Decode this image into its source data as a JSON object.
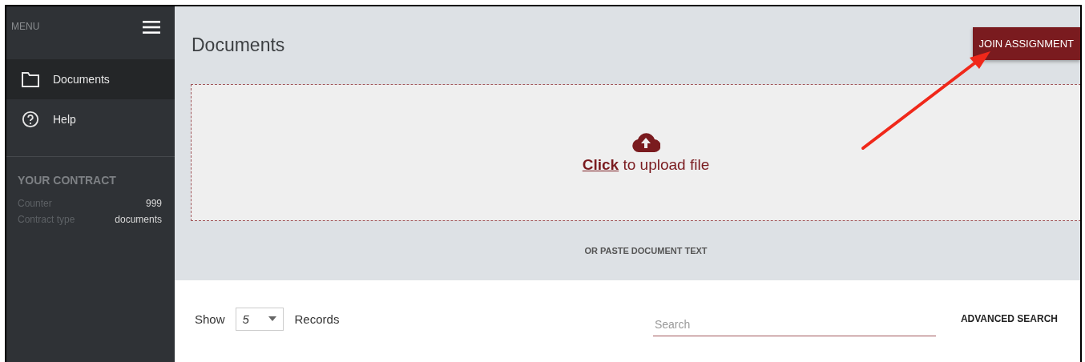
{
  "sidebar": {
    "title": "MENU",
    "items": [
      {
        "label": "Documents",
        "kind": "folder",
        "selected": true
      },
      {
        "label": "Help",
        "kind": "help",
        "selected": false
      }
    ],
    "contract": {
      "heading": "YOUR CONTRACT",
      "fields": [
        {
          "label": "Counter",
          "value": "999"
        },
        {
          "label": "Contract type",
          "value": "documents"
        }
      ]
    }
  },
  "page": {
    "title": "Documents",
    "join_button": "JOIN ASSIGNMENT"
  },
  "upload": {
    "link": "Click",
    "text": "to upload file"
  },
  "paste_label": "OR PASTE DOCUMENT TEXT",
  "records": {
    "show_label": "Show",
    "page_size": "5",
    "records_label": "Records",
    "search": {
      "placeholder": "Search"
    },
    "advanced_search": "ADVANCED SEARCH"
  }
}
